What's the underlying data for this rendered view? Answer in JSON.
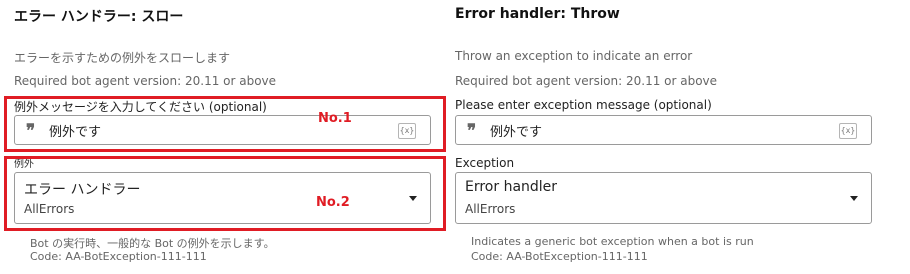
{
  "left": {
    "title": "エラー ハンドラー: スロー",
    "description": "エラーを示すための例外をスローします",
    "requirement": "Required bot agent version: 20.11 or above",
    "message_label": "例外メッセージを入力してください (optional)",
    "message_value": "例外です",
    "var_button": "{x}",
    "exception_label": "例外",
    "exception_value": "エラー ハンドラー",
    "exception_sub": "AllErrors",
    "hint_line1": "Bot の実行時、一般的な Bot の例外を示します。",
    "hint_line2": "Code: AA-BotException-111-111"
  },
  "right": {
    "title": "Error handler: Throw",
    "description": "Throw an exception to indicate an error",
    "requirement": "Required bot agent version: 20.11 or above",
    "message_label": "Please enter exception message (optional)",
    "message_value": "例外です",
    "var_button": "{x}",
    "exception_label": "Exception",
    "exception_value": "Error handler",
    "exception_sub": "AllErrors",
    "hint_line1": "Indicates a generic bot exception when a bot is run",
    "hint_line2": "Code: AA-BotException-111-111"
  },
  "annotations": {
    "no1": "No.1",
    "no2": "No.2",
    "color": "#e01c24"
  },
  "icons": {
    "quote": "quote-icon",
    "variable": "variable-insert-icon",
    "dropdown": "chevron-down-icon"
  }
}
